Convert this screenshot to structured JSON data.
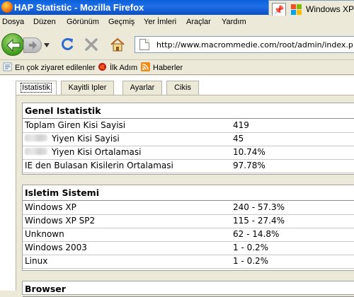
{
  "window": {
    "title": "HAP Statistic - Mozilla Firefox",
    "taskbar_label": "Windows XP",
    "colors": {
      "titlebar": "#0a5fd8",
      "chrome": "#ece9d8"
    }
  },
  "menu": [
    "Dosya",
    "Düzen",
    "Görünüm",
    "Geçmiş",
    "Yer İmleri",
    "Araçlar",
    "Yardım"
  ],
  "nav": {
    "url": "http://www.macrommedie.com/root/admin/index.php",
    "icons": [
      "back-icon",
      "forward-icon",
      "history-dropdown-icon",
      "reload-icon",
      "stop-icon",
      "home-icon",
      "page-icon"
    ]
  },
  "bookmarks": [
    {
      "label": "En çok ziyaret edilenler",
      "icon": "star-icon"
    },
    {
      "label": "İlk Adım",
      "icon": "firefox-icon"
    },
    {
      "label": "Haberler",
      "icon": "rss-icon"
    }
  ],
  "tabs": [
    "Istatistik",
    "Kayitli Ipler",
    "Ayarlar",
    "Cikis"
  ],
  "active_tab": "Istatistik",
  "sections": [
    {
      "title": "Genel Istatistik",
      "rows": [
        {
          "label": "Toplam Giren Kisi Sayisi",
          "value": "419"
        },
        {
          "label": "Yiyen Kisi Sayisi",
          "value": "45",
          "redacted_prefix": true
        },
        {
          "label": "Yiyen Kisi Ortalamasi",
          "value": "10.74%",
          "redacted_prefix": true
        },
        {
          "label": "IE den Bulasan Kisilerin Ortalamasi",
          "value": "97.78%"
        }
      ]
    },
    {
      "title": "Isletim Sistemi",
      "rows": [
        {
          "label": "Windows XP",
          "value": "240 - 57.3%"
        },
        {
          "label": "Windows XP SP2",
          "value": "115 - 27.4%"
        },
        {
          "label": "Unknown",
          "value": "62 - 14.8%"
        },
        {
          "label": "Windows 2003",
          "value": "1 - 0.2%"
        },
        {
          "label": "Linux",
          "value": "1 - 0.2%"
        }
      ]
    },
    {
      "title": "Browser",
      "rows": []
    }
  ]
}
